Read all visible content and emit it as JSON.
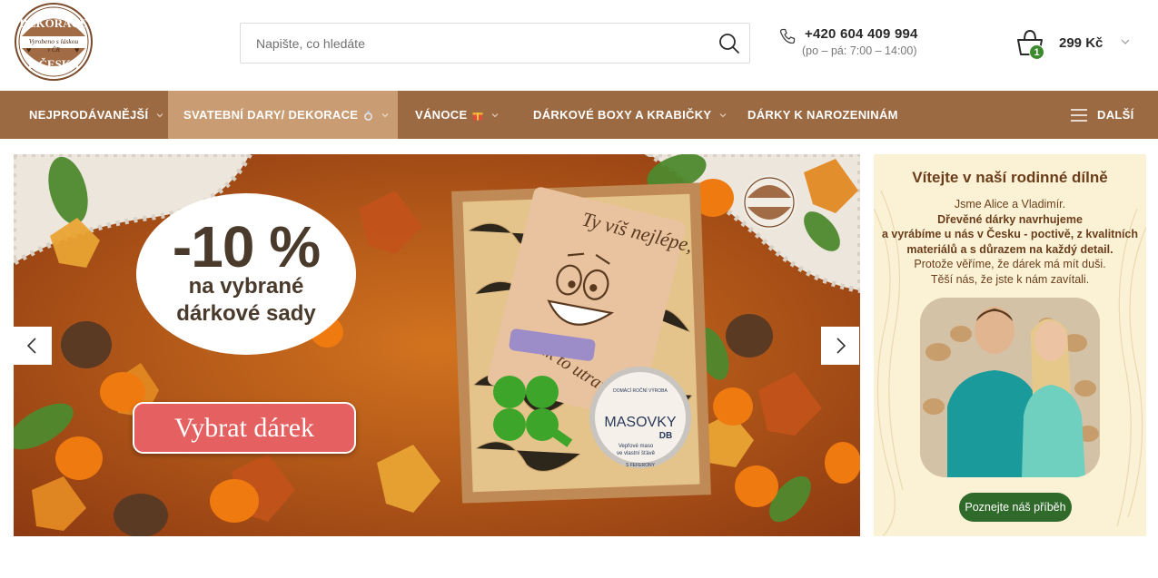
{
  "header": {
    "logo": {
      "top_text": "DEKORACE",
      "middle_text": "Vyrobeno s láskou",
      "middle_text2": "v ČR",
      "bottom_text": "Z ČESKA"
    },
    "search": {
      "placeholder": "Napište, co hledáte"
    },
    "contact": {
      "phone": "+420 604 409 994",
      "hours": "(po – pá: 7:00 – 14:00)"
    },
    "cart": {
      "count": "1",
      "total": "299 Kč"
    }
  },
  "nav": {
    "items": [
      {
        "label": "NEJPRODÁVANĚJŠÍ"
      },
      {
        "label": "SVATEBNÍ DARY/ DEKORACE"
      },
      {
        "label": "VÁNOCE"
      },
      {
        "label": "DÁRKOVÉ BOXY A KRABIČKY"
      },
      {
        "label": "DÁRKY K NAROZENINÁM"
      }
    ],
    "more_label": "DALŠÍ"
  },
  "slider": {
    "discount": "-10 %",
    "line1": "na vybrané",
    "line2": "dárkové sady",
    "cta": "Vybrat dárek",
    "card_line1": "Ty víš nejlépe,",
    "card_line2": "jak to utratit...",
    "jar_title": "MASOVKY",
    "jar_sub": "DB",
    "jar_small1": "Vepřové maso",
    "jar_small2": "ve vlastní šťávě",
    "jar_small3": "S FEFERONY",
    "jar_brand": "DOMÁCÍ ROČNÍ VÝROBA"
  },
  "side": {
    "title": "Vítejte v naší rodinné dílně",
    "line1": "Jsme Alice a Vladimír.",
    "line2": "Dřevěné dárky navrhujeme",
    "line3": "a vyrábíme u nás v Česku - poctivě, z kvalitních",
    "line4": "materiálů a s důrazem na každý detail.",
    "line5": "Protože věříme, že dárek má mít duši.",
    "line6": "Těší nás, že jste k nám zavítali.",
    "button": "Poznejte náš příběh"
  },
  "colors": {
    "nav_bg": "#9b6a43",
    "nav_active": "#c99c74",
    "cta": "#e56060",
    "badge": "#3c8a2e",
    "side_bg": "#fbf2d6",
    "story_btn": "#2f6a2a"
  }
}
